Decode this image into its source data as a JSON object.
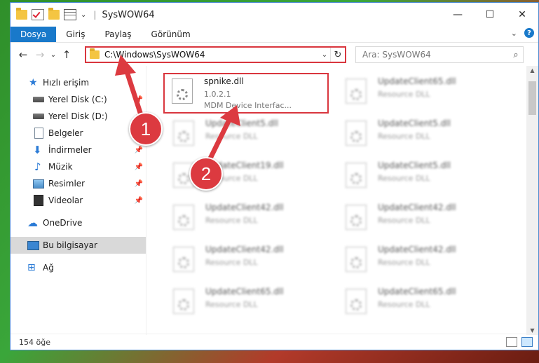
{
  "window": {
    "title": "SysWOW64",
    "controls": {
      "minimize": "—",
      "maximize": "☐",
      "close": "✕"
    }
  },
  "ribbon": {
    "tabs": [
      "Dosya",
      "Giriş",
      "Paylaş",
      "Görünüm"
    ],
    "expand_glyph": "⌄",
    "help_glyph": "?"
  },
  "nav": {
    "back": "←",
    "forward": "→",
    "recent": "⌄",
    "up": "↑",
    "address": "C:\\Windows\\SysWOW64",
    "refresh": "↻",
    "search_placeholder": "Ara: SysWOW64",
    "search_glyph": "⌕"
  },
  "sidebar": {
    "items": [
      {
        "label": "Hızlı erişim",
        "icon": "star-icon",
        "glyph": "★",
        "pinned": false
      },
      {
        "label": "Yerel Disk (C:)",
        "icon": "drive-icon",
        "pinned": true
      },
      {
        "label": "Yerel Disk (D:)",
        "icon": "drive-icon",
        "pinned": true
      },
      {
        "label": "Belgeler",
        "icon": "document-icon",
        "pinned": true
      },
      {
        "label": "İndirmeler",
        "icon": "download-icon",
        "glyph": "⬇",
        "pinned": true
      },
      {
        "label": "Müzik",
        "icon": "music-icon",
        "glyph": "♪",
        "pinned": true
      },
      {
        "label": "Resimler",
        "icon": "pictures-icon",
        "pinned": true
      },
      {
        "label": "Videolar",
        "icon": "video-icon",
        "pinned": true
      },
      {
        "label": "OneDrive",
        "icon": "cloud-icon",
        "glyph": "☁"
      },
      {
        "label": "Bu bilgisayar",
        "icon": "computer-icon",
        "selected": true
      },
      {
        "label": "Ağ",
        "icon": "network-icon",
        "glyph": "⊞"
      }
    ],
    "pin_glyph": "📌"
  },
  "files": {
    "highlighted": {
      "name": "spnike.dll",
      "version": "1.0.2.1",
      "description": "MDM Device Interfac..."
    },
    "blurred": [
      {
        "name": "UpdateClient65.dll",
        "description": "Resource DLL"
      },
      {
        "name": "UpdateClient5.dll",
        "description": "Resource DLL"
      },
      {
        "name": "UpdateClient5.dll",
        "description": "Resource DLL"
      },
      {
        "name": "UpdateClient19.dll",
        "description": "Resource DLL"
      },
      {
        "name": "UpdateClient5.dll",
        "description": "Resource DLL"
      },
      {
        "name": "UpdateClient42.dll",
        "description": "Resource DLL"
      },
      {
        "name": "UpdateClient42.dll",
        "description": "Resource DLL"
      },
      {
        "name": "UpdateClient42.dll",
        "description": "Resource DLL"
      },
      {
        "name": "UpdateClient42.dll",
        "description": "Resource DLL"
      },
      {
        "name": "UpdateClient65.dll",
        "description": "Resource DLL"
      },
      {
        "name": "UpdateClient65.dll",
        "description": "Resource DLL"
      }
    ]
  },
  "status": {
    "item_count": "154 öğe"
  },
  "callouts": [
    "1",
    "2"
  ],
  "colors": {
    "accent": "#1979ca",
    "highlight_red": "#d9363e",
    "callout_red": "#dc3a40"
  }
}
